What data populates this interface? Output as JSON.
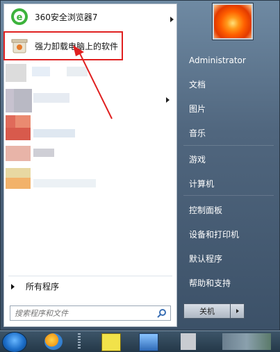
{
  "start_menu": {
    "pinned": [
      {
        "label": "360安全浏览器7",
        "icon": "browser-icon",
        "has_submenu": true
      },
      {
        "label": "强力卸载电脑上的软件",
        "icon": "uninstall-icon",
        "has_submenu": false
      }
    ],
    "all_programs_label": "所有程序",
    "search_placeholder": "搜索程序和文件"
  },
  "right_pane": {
    "user_name": "Administrator",
    "items": [
      "文档",
      "图片",
      "音乐",
      "游戏",
      "计算机",
      "控制面板",
      "设备和打印机",
      "默认程序",
      "帮助和支持"
    ],
    "shutdown_label": "关机"
  },
  "colors": {
    "highlight_border": "#e02020",
    "right_pane_bg": "#50667e",
    "taskbar_bg": "#243848"
  }
}
